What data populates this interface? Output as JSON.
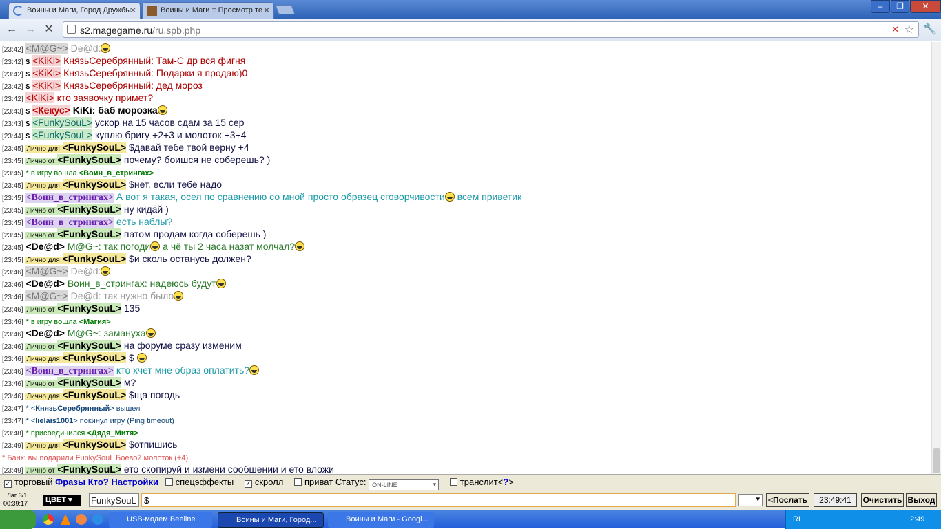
{
  "browser": {
    "tabs": [
      {
        "title": "Воины и Маги, Город Дружбы"
      },
      {
        "title": "Воины и Маги :: Просмотр те"
      }
    ],
    "url_host": "s2.magegame.ru",
    "url_path": "/ru.spb.php"
  },
  "chat": [
    {
      "t": "[23:42]",
      "pre": "",
      "name": "<M@G~>",
      "cls": "nm-mag",
      "msg": "De@d:",
      "mc": "#999",
      "smile": true
    },
    {
      "t": "[23:42]",
      "pre": "$",
      "name": "<KiKi>",
      "cls": "nm-kiki",
      "msg": "КнязьСеребрянный: Там-С др вся фигня",
      "mc": "#a00"
    },
    {
      "t": "[23:42]",
      "pre": "$",
      "name": "<KiKi>",
      "cls": "nm-kiki",
      "msg": "КнязьСеребрянный: Подарки я продаю)0",
      "mc": "#a00"
    },
    {
      "t": "[23:42]",
      "pre": "$",
      "name": "<KiKi>",
      "cls": "nm-kiki",
      "msg": "КнязьСеребрянный: дед мороз",
      "mc": "#a00"
    },
    {
      "t": "[23:42]",
      "pre": "",
      "name": "<KiKi>",
      "cls": "nm-kiki",
      "msg": "кто заявочку примет?",
      "mc": "#a00"
    },
    {
      "t": "[23:43]",
      "pre": "$",
      "name": "<Кекус>",
      "cls": "nm-kekus",
      "msg": "KiKi: баб морозка",
      "mc": "#000",
      "bold": true,
      "smile": true
    },
    {
      "t": "[23:43]",
      "pre": "$",
      "name": "<FunkySouL>",
      "cls": "nm-funky",
      "msg": "ускор на 15 часов сдам за 15 сер",
      "mc": "#114"
    },
    {
      "t": "[23:44]",
      "pre": "$",
      "name": "<FunkySouL>",
      "cls": "nm-funky",
      "msg": "куплю бригу +2+3 и молоток +3+4",
      "mc": "#114"
    },
    {
      "t": "[23:45]",
      "priv": "Лично для",
      "pcls": "pl",
      "pn": "<FunkySouL>",
      "pncls": "fs2",
      "msg": "$давай тебе твой верну +4",
      "mc": "#114"
    },
    {
      "t": "[23:45]",
      "priv": "Лично от",
      "pcls": "pf",
      "pn": "<FunkySouL>",
      "pncls": "fs",
      "msg": "почему? боишся не соберешь? )",
      "mc": "#114"
    },
    {
      "t": "[23:45]",
      "sys": "* в игру вошла ",
      "sysname": "<Воин_в_стрингах>"
    },
    {
      "t": "[23:45]",
      "priv": "Лично для",
      "pcls": "pl",
      "pn": "<FunkySouL>",
      "pncls": "fs2",
      "msg": "$нет, если тебе надо",
      "mc": "#114"
    },
    {
      "t": "[23:45]",
      "pre": "",
      "name": "<Воин_в_стрингах>",
      "cls": "nm-voin",
      "msg": "А вот я такая, осел по сравнению со мной просто образец сговорчивости",
      "mc": "#1a9aa8",
      "smile": true,
      "tail": "всем приветик"
    },
    {
      "t": "[23:45]",
      "priv": "Лично от",
      "pcls": "pf",
      "pn": "<FunkySouL>",
      "pncls": "fs",
      "msg": "ну кидай )",
      "mc": "#114"
    },
    {
      "t": "[23:45]",
      "pre": "",
      "name": "<Воин_в_стрингах>",
      "cls": "nm-voin",
      "msg": "есть наблы?",
      "mc": "#1a9aa8"
    },
    {
      "t": "[23:45]",
      "priv": "Лично от",
      "pcls": "pf",
      "pn": "<FunkySouL>",
      "pncls": "fs",
      "msg": "патом продам когда соберешь )",
      "mc": "#114"
    },
    {
      "t": "[23:45]",
      "pre": "",
      "name": "<De@d>",
      "cls": "nm-dead",
      "msg": "M@G~: так погоди",
      "mc": "#2a7a2a",
      "smile": true,
      "tail": "а чё ты 2 часа назат молчал?",
      "smile2": true
    },
    {
      "t": "[23:45]",
      "priv": "Лично для",
      "pcls": "pl",
      "pn": "<FunkySouL>",
      "pncls": "fs2",
      "msg": "$и сколь останусь должен?",
      "mc": "#114"
    },
    {
      "t": "[23:46]",
      "pre": "",
      "name": "<M@G~>",
      "cls": "nm-mag",
      "msg": "De@d:",
      "mc": "#999",
      "smile": true
    },
    {
      "t": "[23:46]",
      "pre": "",
      "name": "<De@d>",
      "cls": "nm-dead",
      "msg": "Воин_в_стрингах: надеюсь будут",
      "mc": "#2a7a2a",
      "smile": true
    },
    {
      "t": "[23:46]",
      "pre": "",
      "name": "<M@G~>",
      "cls": "nm-mag",
      "msg": "De@d: так нужно было",
      "mc": "#999",
      "smile": true
    },
    {
      "t": "[23:46]",
      "priv": "Лично от",
      "pcls": "pf",
      "pn": "<FunkySouL>",
      "pncls": "fs",
      "msg": "135",
      "mc": "#114"
    },
    {
      "t": "[23:46]",
      "sys": "* в игру вошла ",
      "sysname": "<Магия>"
    },
    {
      "t": "[23:46]",
      "pre": "",
      "name": "<De@d>",
      "cls": "nm-dead",
      "msg": "M@G~: замануха",
      "mc": "#2a7a2a",
      "smile": true
    },
    {
      "t": "[23:46]",
      "priv": "Лично от",
      "pcls": "pf",
      "pn": "<FunkySouL>",
      "pncls": "fs",
      "msg": "на форуме сразу изменим",
      "mc": "#114"
    },
    {
      "t": "[23:46]",
      "priv": "Лично для",
      "pcls": "pl",
      "pn": "<FunkySouL>",
      "pncls": "fs2",
      "msg": "$",
      "mc": "#114",
      "smile": true
    },
    {
      "t": "[23:46]",
      "pre": "",
      "name": "<Воин_в_стрингах>",
      "cls": "nm-voin",
      "msg": "кто хчет мне образ оплатить?",
      "mc": "#1a9aa8",
      "smile": true
    },
    {
      "t": "[23:46]",
      "priv": "Лично от",
      "pcls": "pf",
      "pn": "<FunkySouL>",
      "pncls": "fs",
      "msg": "м?",
      "mc": "#114"
    },
    {
      "t": "[23:46]",
      "priv": "Лично для",
      "pcls": "pl",
      "pn": "<FunkySouL>",
      "pncls": "fs2",
      "msg": "$ща погодь",
      "mc": "#114"
    },
    {
      "t": "[23:47]",
      "sys2": "* <",
      "sysname": "КнязьСеребрянный",
      "sysend": "> вышел"
    },
    {
      "t": "[23:47]",
      "sys2": "* <",
      "sysname": "lielais1001",
      "sysend": "> покинул игру (Ping timeout)"
    },
    {
      "t": "[23:48]",
      "sys": "* присоединился ",
      "sysname": "<Дядя_Митя>"
    },
    {
      "t": "[23:49]",
      "priv": "Лично для",
      "pcls": "pl",
      "pn": "<FunkySouL>",
      "pncls": "fs2",
      "msg": "$отпишись",
      "mc": "#114"
    },
    {
      "bank": "* Банк: вы подарили FunkySouL Боевой молоток (+4)"
    },
    {
      "t": "[23:49]",
      "priv": "Лично от",
      "pcls": "pf",
      "pn": "<FunkySouL>",
      "pncls": "fs",
      "msg": "ето скопируй и измени сообшении и ето вложи",
      "mc": "#114"
    }
  ],
  "options": {
    "trade": "торговый",
    "phrases": "Фразы",
    "who": "Кто?",
    "settings": "Настройки",
    "effects": "спецэффекты",
    "scroll": "скролл",
    "private": "приват",
    "status_label": "Статус:",
    "status_value": "ON-LINE",
    "translit": "транслит<",
    "translit_q": "?",
    "translit_end": ">"
  },
  "input": {
    "lag": "Лаг 3/1",
    "timer": "00:39:17",
    "color_btn": "ЦВЕТ",
    "nick": "FunkySouL",
    "text": "$",
    "send": "<Послать",
    "time": "23:49:41",
    "clear": "Очистить",
    "exit": "Выход"
  },
  "taskbar": {
    "items": [
      "USB-модем Beeline",
      "Воины и Маги, Город...",
      "Воины и Маги - Googl..."
    ],
    "lang": "RL",
    "clock": "2:49"
  }
}
